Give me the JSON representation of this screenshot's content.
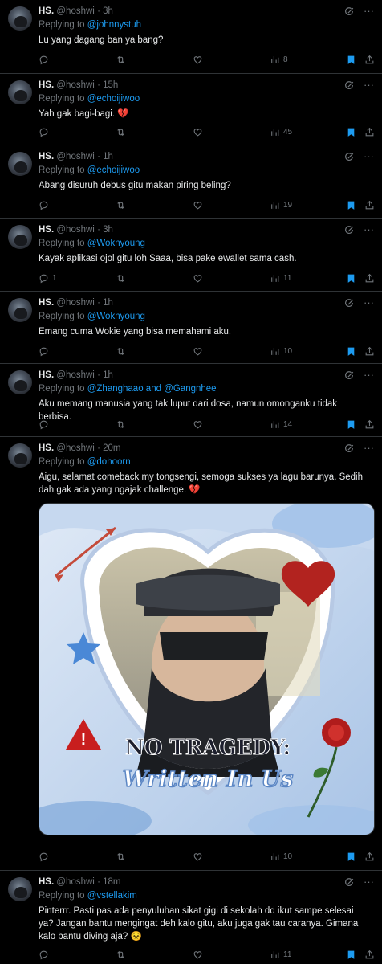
{
  "tweets": [
    {
      "name": "HS.",
      "handle": "@hoshwi",
      "time": "3h",
      "replying_prefix": "Replying to ",
      "replying_to": "@johnnystuh",
      "replying_rest": "",
      "text": "Lu yang dagang ban ya bang?",
      "replies": "",
      "views": "8"
    },
    {
      "name": "HS.",
      "handle": "@hoshwi",
      "time": "15h",
      "replying_prefix": "Replying to ",
      "replying_to": "@echoijiwoo",
      "replying_rest": "",
      "text": "Yah gak bagi-bagi. 💔",
      "replies": "",
      "views": "45"
    },
    {
      "name": "HS.",
      "handle": "@hoshwi",
      "time": "1h",
      "replying_prefix": "Replying to ",
      "replying_to": "@echoijiwoo",
      "replying_rest": "",
      "text": "Abang disuruh debus gitu makan piring beling?",
      "replies": "",
      "views": "19"
    },
    {
      "name": "HS.",
      "handle": "@hoshwi",
      "time": "3h",
      "replying_prefix": "Replying to ",
      "replying_to": "@Woknyoung",
      "replying_rest": "",
      "text": "Kayak aplikasi ojol gitu loh Saaa, bisa pake ewallet sama cash.",
      "replies": "1",
      "views": "11"
    },
    {
      "name": "HS.",
      "handle": "@hoshwi",
      "time": "1h",
      "replying_prefix": "Replying to ",
      "replying_to": "@Woknyoung",
      "replying_rest": "",
      "text": "Emang cuma Wokie yang bisa memahami aku.",
      "replies": "",
      "views": "10"
    },
    {
      "name": "HS.",
      "handle": "@hoshwi",
      "time": "1h",
      "replying_prefix": "Replying to ",
      "replying_to": "@Zhanghaao",
      "replying_rest": " and @Gangnhee",
      "text": "Aku memang manusia yang tak luput dari dosa, namun omonganku tidak berbisa.",
      "replies": "",
      "views": "14"
    },
    {
      "name": "HS.",
      "handle": "@hoshwi",
      "time": "20m",
      "replying_prefix": "Replying to ",
      "replying_to": "@dohoorn",
      "replying_rest": "",
      "text": "Aigu, selamat comeback my tongsengi, semoga sukses ya lagu barunya. Sedih dah gak ada yang ngajak challenge. 💔",
      "replies": "",
      "views": "10",
      "media_line1": "NO TRAGEDY:",
      "media_line2": "Written In Us"
    },
    {
      "name": "HS.",
      "handle": "@hoshwi",
      "time": "18m",
      "replying_prefix": "Replying to ",
      "replying_to": "@vstellakim",
      "replying_rest": "",
      "text": "Pinterrr. Pasti pas ada penyuluhan sikat gigi di sekolah dd ikut sampe selesai ya? Jangan bantu mengingat deh kalo gitu, aku juga gak tau caranya. Gimana kalo bantu diving aja? 😣",
      "replies": "",
      "views": "11"
    }
  ],
  "icons": {
    "reply": "reply-icon",
    "retweet": "retweet-icon",
    "like": "like-icon",
    "views": "views-icon",
    "bookmark": "bookmark-icon",
    "share": "share-icon",
    "grok": "grok-icon",
    "more": "more-icon"
  },
  "colors": {
    "accent": "#1d9bf0",
    "muted": "#71767b",
    "text": "#e7e9ea",
    "divider": "#2f3336"
  }
}
